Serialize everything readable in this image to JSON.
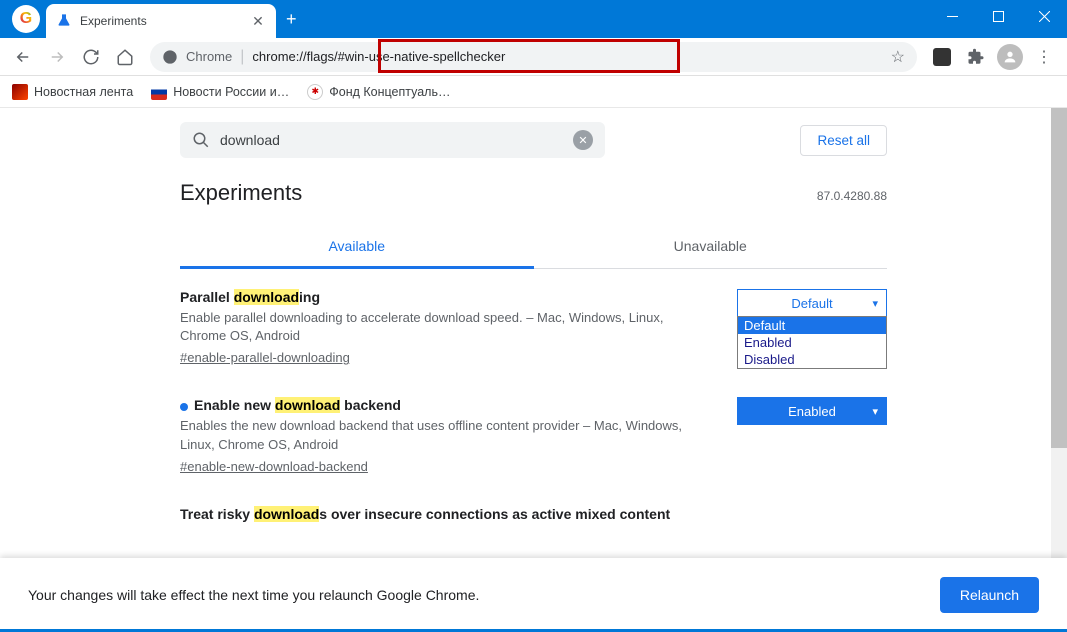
{
  "window": {
    "tab_title": "Experiments"
  },
  "toolbar": {
    "omnibox_label": "Chrome",
    "omnibox_url": "chrome://flags/#win-use-native-spellchecker"
  },
  "bookmarks": [
    {
      "label": "Новостная лента"
    },
    {
      "label": "Новости России и…"
    },
    {
      "label": "Фонд Концептуаль…"
    }
  ],
  "search": {
    "value": "download",
    "reset": "Reset all"
  },
  "header": {
    "title": "Experiments",
    "version": "87.0.4280.88"
  },
  "tabs": {
    "available": "Available",
    "unavailable": "Unavailable"
  },
  "flags": [
    {
      "title_pre": "Parallel ",
      "title_mark": "download",
      "title_post": "ing",
      "desc": "Enable parallel downloading to accelerate download speed. – Mac, Windows, Linux, Chrome OS, Android",
      "hash": "#enable-parallel-downloading",
      "value": "Default",
      "filled": false,
      "dot": false,
      "dropdown_open": true,
      "options": [
        "Default",
        "Enabled",
        "Disabled"
      ]
    },
    {
      "title_pre": "Enable new ",
      "title_mark": "download",
      "title_post": " backend",
      "desc": "Enables the new download backend that uses offline content provider – Mac, Windows, Linux, Chrome OS, Android",
      "hash": "#enable-new-download-backend",
      "value": "Enabled",
      "filled": true,
      "dot": true,
      "dropdown_open": false
    },
    {
      "title_pre": "Treat risky ",
      "title_mark": "download",
      "title_post": "s over insecure connections as active mixed content",
      "desc": "",
      "hash": "",
      "value": "",
      "filled": false,
      "dot": false
    }
  ],
  "footer": {
    "message": "Your changes will take effect the next time you relaunch Google Chrome.",
    "relaunch": "Relaunch"
  }
}
